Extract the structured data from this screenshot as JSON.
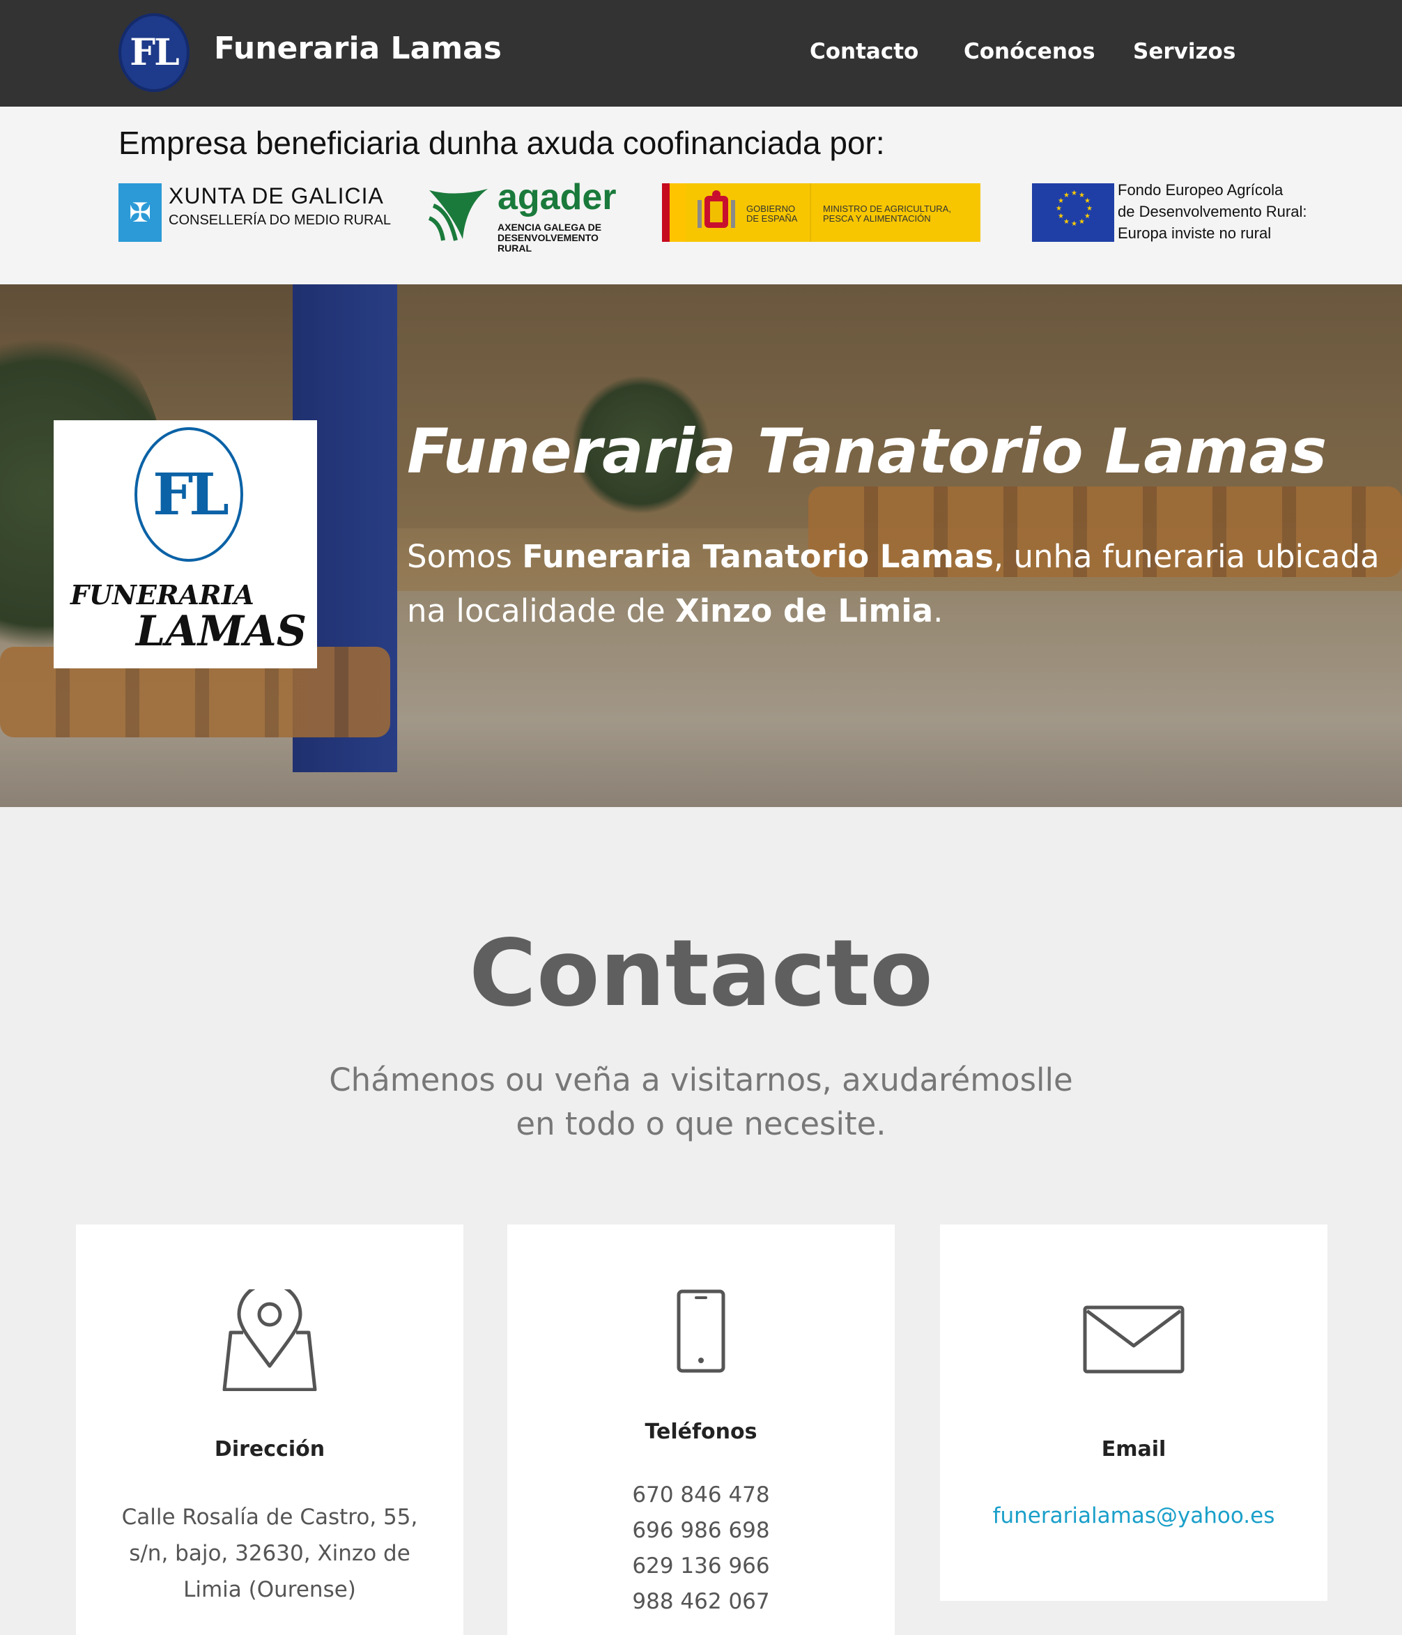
{
  "nav": {
    "logo_text": "FL",
    "brand": "Funeraria Lamas",
    "links": [
      "Contacto",
      "Conócenos",
      "Servizos"
    ]
  },
  "funding": {
    "headline": "Empresa beneficiaria dunha axuda coofinanciada por:",
    "xunta": {
      "title": "XUNTA DE GALICIA",
      "subtitle": "CONSELLERÍA DO MEDIO RURAL"
    },
    "agader": {
      "word": "agader",
      "subtitle": "AXENCIA GALEGA DE DESENVOLVEMENTO RURAL"
    },
    "gobierno": {
      "text1": "GOBIERNO DE ESPAÑA",
      "text2": "MINISTRO DE AGRICULTURA, PESCA Y ALIMENTACIÓN"
    },
    "eu": {
      "line1": "Fondo Europeo Agrícola",
      "line2": "de Desenvolvemento Rural:",
      "line3": "Europa inviste no rural"
    }
  },
  "hero": {
    "logo_top": "FL",
    "logo_word1": "FUNERARIA",
    "logo_word2": "LAMAS",
    "title": "Funeraria Tanatorio Lamas",
    "desc_pre": "Somos ",
    "desc_bold1": "Funeraria Tanatorio Lamas",
    "desc_mid": ", unha funeraria ubicada na localidade de ",
    "desc_bold2": "Xinzo de Limia",
    "desc_end": "."
  },
  "contact": {
    "title": "Contacto",
    "subtitle": "Chámenos ou veña a visitarnos, axudarémoslle en todo o que necesite.",
    "cards": {
      "address": {
        "icon": "map-pin-icon",
        "title": "Dirección",
        "text": "Calle Rosalía de Castro, 55, s/n, bajo, 32630, Xinzo de Limia (Ourense)"
      },
      "phones": {
        "icon": "smartphone-icon",
        "title": "Teléfonos",
        "numbers": [
          "670 846 478",
          "696 986 698",
          "629 136 966",
          "988 462 067"
        ]
      },
      "email": {
        "icon": "envelope-icon",
        "title": "Email",
        "address": "funerarialamas@yahoo.es"
      }
    }
  },
  "colors": {
    "nav_bg": "#333333",
    "accent_link": "#1a9fc9",
    "page_bg": "#efefef"
  }
}
